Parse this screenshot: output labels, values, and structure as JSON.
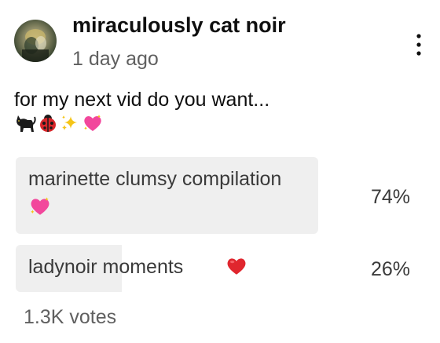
{
  "post": {
    "author": "miraculously cat noir",
    "time": "1 day ago",
    "text": "for my next vid do you want...",
    "emoji_icons": [
      "black-cat-icon",
      "ladybug-icon",
      "sparkles-icon",
      "sparkling-heart-icon"
    ]
  },
  "poll": {
    "options": [
      {
        "label": "marinette clumsy compilation",
        "icon": "sparkling-heart-icon",
        "percent_label": "74%",
        "percent": 74
      },
      {
        "label": "ladynoir moments",
        "icon": "red-heart-icon",
        "percent_label": "26%",
        "percent": 26
      }
    ],
    "votes": "1.3K votes"
  },
  "colors": {
    "bar": "#efefef",
    "heart_pink": "#f2479c",
    "heart_red": "#e0262e"
  }
}
